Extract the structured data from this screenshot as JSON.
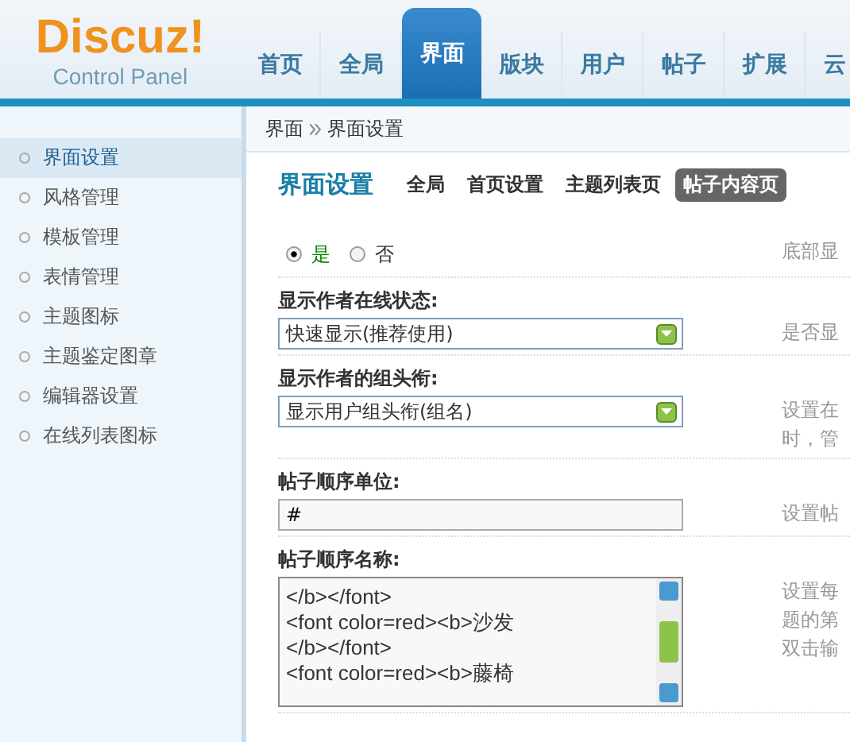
{
  "logo": {
    "title": "Discuz!",
    "subtitle": "Control Panel"
  },
  "nav_tabs": [
    {
      "label": "首页",
      "selected": false
    },
    {
      "label": "全局",
      "selected": false
    },
    {
      "label": "界面",
      "selected": true
    },
    {
      "label": "版块",
      "selected": false
    },
    {
      "label": "用户",
      "selected": false
    },
    {
      "label": "帖子",
      "selected": false
    },
    {
      "label": "扩展",
      "selected": false
    },
    {
      "label": "云",
      "selected": false
    }
  ],
  "breadcrumb": [
    "界面",
    "界面设置"
  ],
  "sidebar": {
    "items": [
      {
        "label": "界面设置",
        "selected": true
      },
      {
        "label": "风格管理",
        "selected": false
      },
      {
        "label": "模板管理",
        "selected": false
      },
      {
        "label": "表情管理",
        "selected": false
      },
      {
        "label": "主题图标",
        "selected": false
      },
      {
        "label": "主题鉴定图章",
        "selected": false
      },
      {
        "label": "编辑器设置",
        "selected": false
      },
      {
        "label": "在线列表图标",
        "selected": false
      }
    ]
  },
  "page_title": "界面设置",
  "sub_tabs": [
    {
      "label": "全局",
      "selected": false
    },
    {
      "label": "首页设置",
      "selected": false
    },
    {
      "label": "主题列表页",
      "selected": false
    },
    {
      "label": "帖子内容页",
      "selected": true
    }
  ],
  "settings": [
    {
      "kind": "radio",
      "options": [
        {
          "label": "是",
          "selected": true
        },
        {
          "label": "否",
          "selected": false
        }
      ],
      "hint": [
        "底部显"
      ]
    },
    {
      "kind": "select",
      "label": "显示作者在线状态:",
      "value": "快速显示(推荐使用)",
      "hint": [
        "是否显"
      ]
    },
    {
      "kind": "select",
      "label": "显示作者的组头衔:",
      "value": "显示用户组头衔(组名)",
      "hint": [
        "设置在",
        "时，管"
      ]
    },
    {
      "kind": "text",
      "label": "帖子顺序单位:",
      "value": "#",
      "hint": [
        "设置帖"
      ]
    },
    {
      "kind": "textarea",
      "label": "帖子顺序名称:",
      "lines": [
        "</b></font>",
        "<font color=red><b>沙发",
        "</b></font>",
        "<font color=red><b>藤椅"
      ],
      "hint": [
        "设置每",
        "题的第",
        "双击输"
      ]
    }
  ]
}
